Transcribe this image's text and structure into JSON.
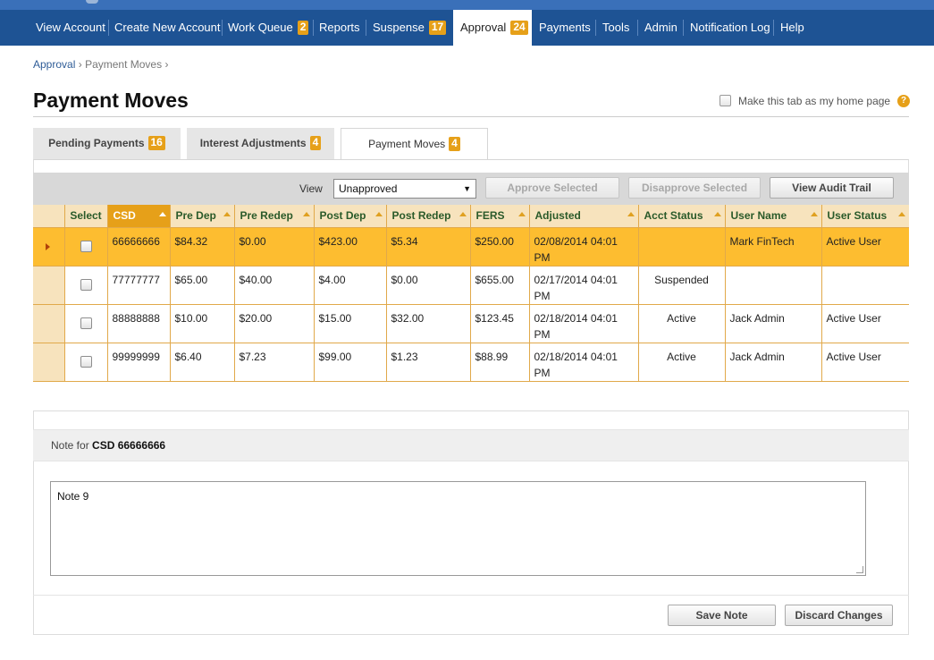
{
  "nav": {
    "items": [
      {
        "label": "View Account"
      },
      {
        "label": "Create New Account"
      },
      {
        "label": "Work Queue",
        "badge": "2"
      },
      {
        "label": "Reports"
      },
      {
        "label": "Suspense",
        "badge": "17"
      },
      {
        "label": "Approval",
        "badge": "24",
        "active": true
      },
      {
        "label": "Payments"
      },
      {
        "label": "Tools"
      },
      {
        "label": "Admin"
      },
      {
        "label": "Notification Log"
      },
      {
        "label": "Help"
      }
    ]
  },
  "breadcrumb": {
    "root": "Approval",
    "current": "Payment Moves",
    "sep": "›"
  },
  "page": {
    "title": "Payment Moves",
    "home_label": "Make this tab as my home page",
    "help_glyph": "?"
  },
  "tabs": [
    {
      "label": "Pending Payments",
      "badge": "16"
    },
    {
      "label": "Interest Adjustments",
      "badge": "4"
    },
    {
      "label": "Payment Moves",
      "badge": "4",
      "active": true
    }
  ],
  "toolbar": {
    "view_label": "View",
    "view_value": "Unapproved",
    "approve_label": "Approve Selected",
    "disapprove_label": "Disapprove Selected",
    "audit_label": "View Audit Trail"
  },
  "grid": {
    "columns": [
      "Select",
      "CSD",
      "Pre Dep",
      "Pre Redep",
      "Post Dep",
      "Post Redep",
      "FERS",
      "Adjusted",
      "Acct Status",
      "User Name",
      "User Status"
    ],
    "rows": [
      {
        "csd": "66666666",
        "pre_dep": "$84.32",
        "pre_redep": "$0.00",
        "post_dep": "$423.00",
        "post_redep": "$5.34",
        "fers": "$250.00",
        "adjusted": "02/08/2014 04:01 PM",
        "acct_status": "",
        "user_name": "Mark FinTech",
        "user_status": "Active User",
        "selected": true
      },
      {
        "csd": "77777777",
        "pre_dep": "$65.00",
        "pre_redep": "$40.00",
        "post_dep": "$4.00",
        "post_redep": "$0.00",
        "fers": "$655.00",
        "adjusted": "02/17/2014 04:01 PM",
        "acct_status": "Suspended",
        "user_name": "",
        "user_status": ""
      },
      {
        "csd": "88888888",
        "pre_dep": "$10.00",
        "pre_redep": "$20.00",
        "post_dep": "$15.00",
        "post_redep": "$32.00",
        "fers": "$123.45",
        "adjusted": "02/18/2014 04:01 PM",
        "acct_status": "Active",
        "user_name": "Jack Admin",
        "user_status": "Active User"
      },
      {
        "csd": "99999999",
        "pre_dep": "$6.40",
        "pre_redep": "$7.23",
        "post_dep": "$99.00",
        "post_redep": "$1.23",
        "fers": "$88.99",
        "adjusted": "02/18/2014 04:01 PM",
        "acct_status": "Active",
        "user_name": "Jack Admin",
        "user_status": "Active User"
      }
    ]
  },
  "note": {
    "title_prefix": "Note for",
    "title_csd": "CSD 66666666",
    "text": "Note 9",
    "save_label": "Save Note",
    "discard_label": "Discard Changes"
  },
  "colors": {
    "nav_bg": "#1e5394",
    "accent": "#e6a019",
    "selected_row": "#fdbd30",
    "header_bg": "#f7e3bd"
  }
}
